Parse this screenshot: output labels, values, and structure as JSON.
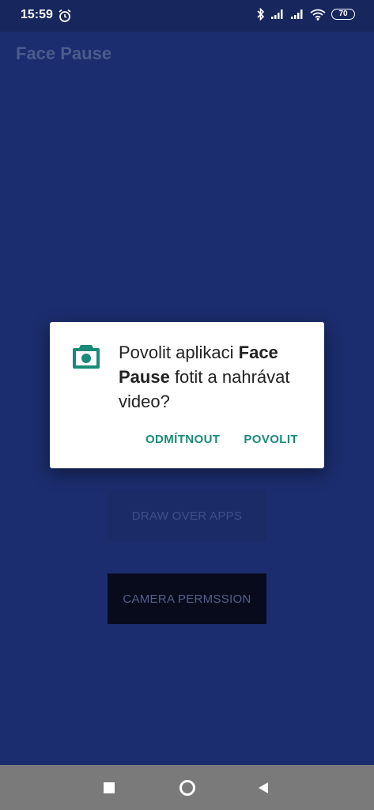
{
  "status_bar": {
    "time": "15:59",
    "battery": "70",
    "icons": [
      "alarm-icon",
      "bluetooth-icon",
      "signal-icon",
      "signal-icon",
      "wifi-icon",
      "battery-icon"
    ]
  },
  "app_bar": {
    "title": "Face Pause"
  },
  "buttons": {
    "draw_over_apps": "DRAW OVER APPS",
    "camera_permission": "CAMERA PERMSSION"
  },
  "dialog": {
    "icon": "camera-icon",
    "message_prefix": "Povolit aplikaci ",
    "app_name": "Face Pause",
    "message_suffix": " fotit a nahrávat video?",
    "deny_label": "ODMÍTNOUT",
    "allow_label": "POVOLIT"
  },
  "nav_bar": {
    "icons": [
      "recents-icon",
      "home-icon",
      "back-icon"
    ]
  },
  "colors": {
    "background": "#1b2d6e",
    "accent": "#1a8a79",
    "nav_bar": "#7a7a7a"
  }
}
